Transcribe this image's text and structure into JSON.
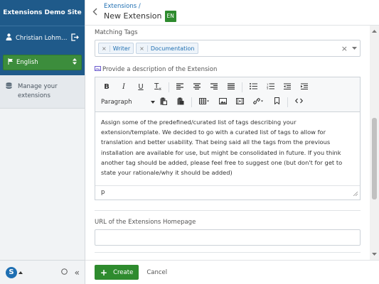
{
  "sidebar": {
    "site_title": "Extensions Demo Site",
    "user_name": "Christian Lohm…",
    "language": "English",
    "nav_item": "Manage your extensions",
    "collapse_glyph": "«",
    "logo_letter": "S"
  },
  "header": {
    "breadcrumb": "Extensions /",
    "title": "New Extension",
    "lang_badge": "EN"
  },
  "form": {
    "tags_label": "Matching Tags",
    "tags": [
      "Writer",
      "Documentation"
    ],
    "description_label": "Provide a description of the Extension",
    "editor_format": "Paragraph",
    "description_text": "Assign some of the predefined/curated list of tags describing your extension/template. We decided to go with a curated list of tags to allow for translation and better usability. That being said all the tags from the previous installation are available for use, but might be consolidated in future. If you think another tag should be added, please feel free to suggest one (but don't for get to state your rationale/why it should be added)",
    "editor_path": "p",
    "url_label": "URL of the Extensions Homepage",
    "url_value": ""
  },
  "footer": {
    "create_label": "Create",
    "cancel_label": "Cancel"
  },
  "colors": {
    "sidebar_header": "#1f5a8a",
    "primary_green": "#2e8b2e",
    "link_blue": "#1f6fb2"
  }
}
